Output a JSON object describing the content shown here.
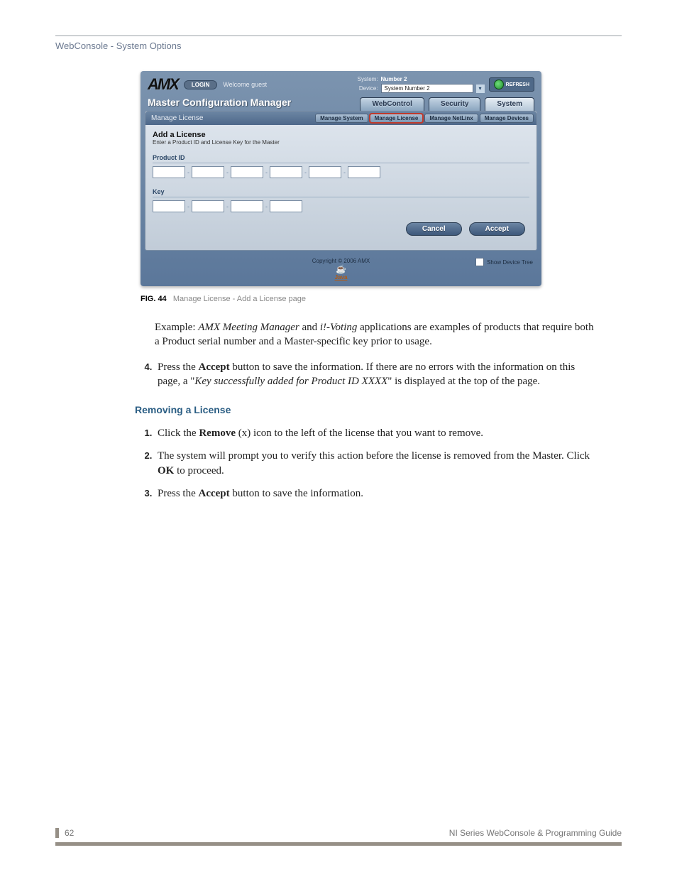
{
  "header": {
    "title": "WebConsole - System Options"
  },
  "screenshot": {
    "login_label": "LOGIN",
    "welcome": "Welcome guest",
    "system_label": "System:",
    "system_value": "Number 2",
    "device_label": "Device:",
    "device_value": "System Number 2",
    "refresh": "REFRESH",
    "mcm": "Master Configuration Manager",
    "main_tabs": [
      "WebControl",
      "Security",
      "System"
    ],
    "panel_title": "Manage License",
    "sub_tabs": [
      "Manage System",
      "Manage License",
      "Manage NetLinx",
      "Manage Devices"
    ],
    "add_title": "Add a License",
    "add_sub": "Enter a Product ID and License Key for the Master",
    "product_id_label": "Product ID",
    "key_label": "Key",
    "cancel": "Cancel",
    "accept": "Accept",
    "copyright": "Copyright © 2006 AMX",
    "java": "Java",
    "show_device_tree": "Show Device Tree"
  },
  "caption": {
    "fig": "FIG. 44",
    "text": "Manage License - Add a License page"
  },
  "paragraphs": {
    "example_pre": "Example: ",
    "example_em1": "AMX Meeting Manager",
    "example_mid": " and ",
    "example_em2": "i!-Voting",
    "example_post": " applications are examples of products that require both a Product serial number and a Master-specific key prior to usage."
  },
  "step4": {
    "pre": "Press the ",
    "b1": "Accept",
    "mid": " button to save the information. If there are no errors with the information on this page, a \"",
    "em": "Key successfully added for Product ID XXXX",
    "post": "\" is displayed at the top of the page."
  },
  "section2": {
    "heading": "Removing a License"
  },
  "rem_steps": {
    "s1_pre": "Click the ",
    "s1_b": "Remove",
    "s1_post": " (x) icon to the left of the license that you want to remove.",
    "s2_pre": "The system will prompt you to verify this action before the license is removed from the Master. Click ",
    "s2_b": "OK",
    "s2_post": " to proceed.",
    "s3_pre": "Press the ",
    "s3_b": "Accept",
    "s3_post": " button to save the information."
  },
  "footer": {
    "page": "62",
    "title": "NI Series WebConsole & Programming Guide"
  }
}
